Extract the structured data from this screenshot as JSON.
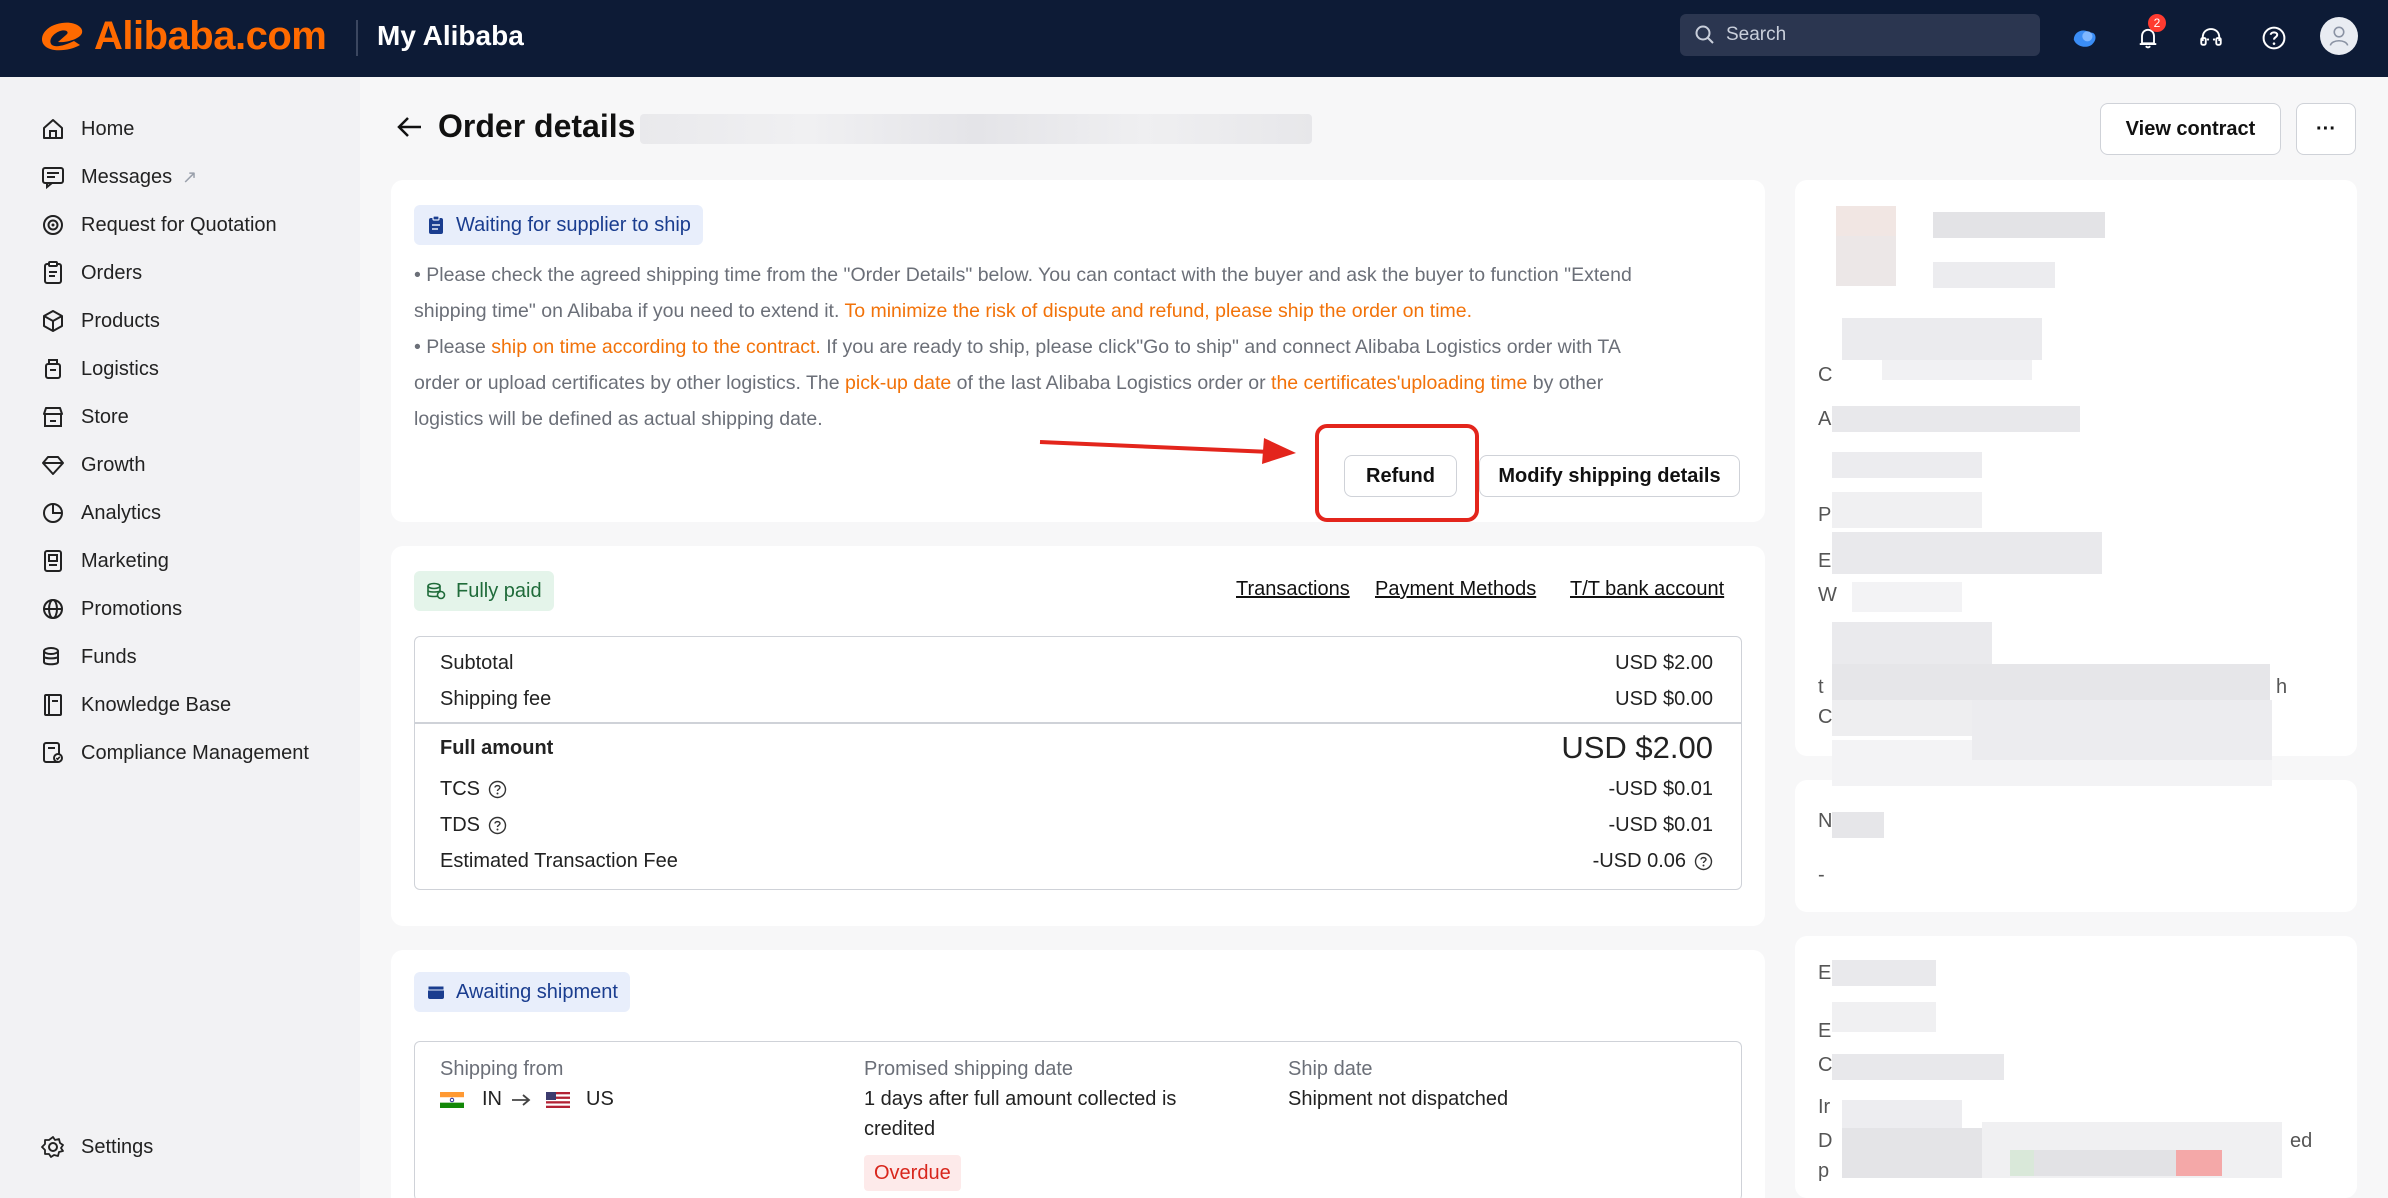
{
  "topbar": {
    "brand": "Alibaba.com",
    "section": "My Alibaba",
    "search_placeholder": "Search",
    "notification_count": "2"
  },
  "sidebar": {
    "items": [
      {
        "label": "Home",
        "icon": "home-icon"
      },
      {
        "label": "Messages",
        "icon": "message-icon",
        "external": "↗"
      },
      {
        "label": "Request for Quotation",
        "icon": "target-icon"
      },
      {
        "label": "Orders",
        "icon": "clipboard-icon"
      },
      {
        "label": "Products",
        "icon": "box-icon"
      },
      {
        "label": "Logistics",
        "icon": "truck-icon"
      },
      {
        "label": "Store",
        "icon": "store-icon"
      },
      {
        "label": "Growth",
        "icon": "growth-icon"
      },
      {
        "label": "Analytics",
        "icon": "pie-chart-icon"
      },
      {
        "label": "Marketing",
        "icon": "marketing-icon"
      },
      {
        "label": "Promotions",
        "icon": "globe-icon"
      },
      {
        "label": "Funds",
        "icon": "coins-icon"
      },
      {
        "label": "Knowledge Base",
        "icon": "book-icon"
      },
      {
        "label": "Compliance Management",
        "icon": "compliance-icon"
      }
    ],
    "settings_label": "Settings"
  },
  "header": {
    "title": "Order details",
    "view_contract": "View contract",
    "more": "···"
  },
  "status_card": {
    "tag": "Waiting for supplier to ship",
    "p1_a": "• Please check the agreed shipping time from the \"Order Details\" below. You can contact with the buyer and ask the buyer to function \"Extend",
    "p1_b": "shipping time\" on Alibaba if you need to extend it. ",
    "p1_orange": "To minimize the risk of dispute and refund, please ship the order on time.",
    "p2_a": "• Please ",
    "p2_o1": "ship on time according to the contract.",
    "p2_b": " If you are ready to ship, please click\"Go to ship\" and connect Alibaba Logistics order with TA",
    "p2_c": "order or upload certificates by other logistics. The ",
    "p2_o2": "pick-up date",
    "p2_d": " of the last Alibaba Logistics order or ",
    "p2_o3": "the certificates'uploading time",
    "p2_e": " by other",
    "p2_f": "logistics will be defined as actual shipping date.",
    "refund": "Refund",
    "modify": "Modify shipping details"
  },
  "payment_card": {
    "tag": "Fully paid",
    "links": [
      "Transactions",
      "Payment Methods",
      "T/T bank account"
    ],
    "subtotal_label": "Subtotal",
    "subtotal_value": "USD $2.00",
    "shipping_label": "Shipping fee",
    "shipping_value": "USD $0.00",
    "full_label": "Full amount",
    "full_value": "USD $2.00",
    "tcs_label": "TCS",
    "tcs_value": "-USD $0.01",
    "tds_label": "TDS",
    "tds_value": "-USD $0.01",
    "fee_label": "Estimated Transaction Fee",
    "fee_value": "-USD 0.06"
  },
  "shipment_card": {
    "tag": "Awaiting shipment",
    "from_label": "Shipping from",
    "from_origin": "IN",
    "from_dest": "US",
    "promised_label": "Promised shipping date",
    "promised_value_1": "1 days after full amount collected is",
    "promised_value_2": "credited",
    "overdue": "Overdue",
    "ship_label": "Ship date",
    "ship_value": "Shipment not dispatched"
  },
  "right_panel": {
    "partial_letters": [
      "C",
      "A",
      "P",
      "E",
      "W",
      "t",
      "C",
      "h",
      "N",
      "-",
      "E",
      "E",
      "C",
      "Ir",
      "D",
      "p",
      "ed"
    ]
  }
}
